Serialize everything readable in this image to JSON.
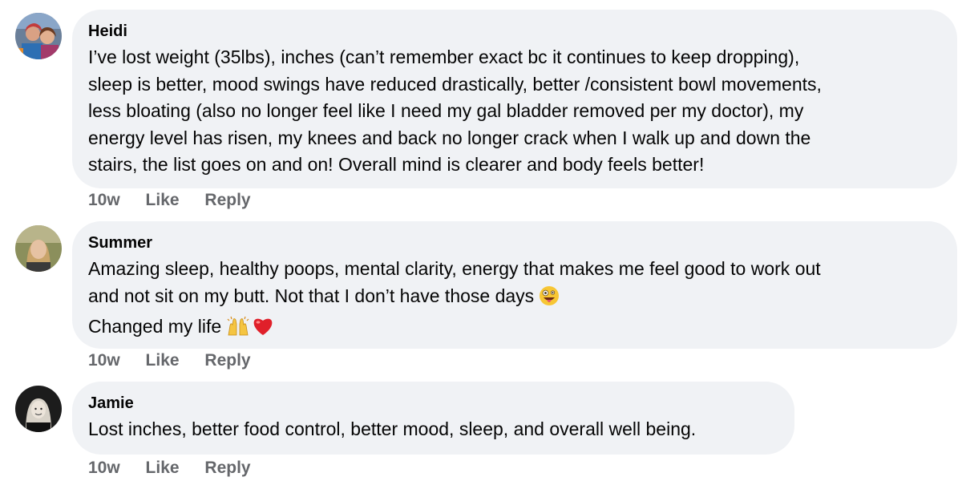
{
  "comments": [
    {
      "author": "Heidi",
      "lines": [
        "I’ve lost weight (35lbs), inches (can’t remember exact bc it continues to keep dropping),",
        "sleep is better, mood swings have reduced drastically, better /consistent bowl movements,",
        "less bloating (also no longer feel like I need my gal bladder removed per my doctor), my",
        "energy level has risen, my knees and back no longer crack when I walk up and down the",
        "stairs, the list goes on and on! Overall mind is clearer and body feels better!"
      ],
      "time": "10w",
      "like": "Like",
      "reply": "Reply"
    },
    {
      "author": "Summer",
      "lines": [
        "Amazing sleep, healthy poops, mental clarity, energy that makes me feel good to work out",
        "and not sit on my butt. Not that I don’t have those days",
        "Changed my life"
      ],
      "emojis": [
        "zany-face-emoji",
        "raising-hands-emoji",
        "red-heart-emoji"
      ],
      "time": "10w",
      "like": "Like",
      "reply": "Reply"
    },
    {
      "author": "Jamie",
      "lines": [
        "Lost inches, better food control, better mood, sleep, and overall well being."
      ],
      "time": "10w",
      "like": "Like",
      "reply": "Reply"
    }
  ],
  "colors": {
    "bubble": "#f0f2f5",
    "text": "#050505",
    "meta": "#65676b"
  }
}
